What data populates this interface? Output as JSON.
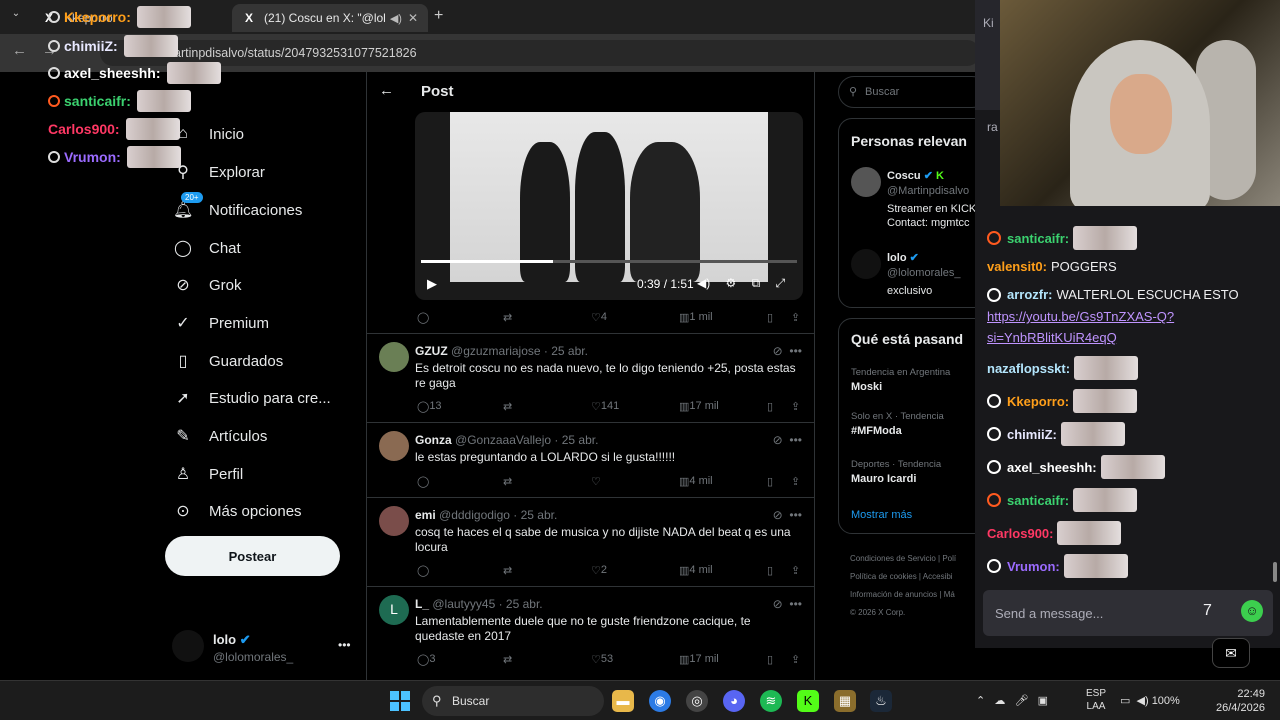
{
  "browser": {
    "tabs": [
      {
        "title": "Kkeporro",
        "favicon": "X"
      },
      {
        "title": "(21) Coscu en X: \"@lolomo",
        "favicon": "X"
      }
    ],
    "url": "artinpdisalvo/status/2047932531077521826",
    "new_tab": "+"
  },
  "left_overlay": [
    {
      "user": "chimiiZ:",
      "color": "#e8e8ff"
    },
    {
      "user": "axel_sheeshh:",
      "color": "#ffffff"
    },
    {
      "user": "santicaifr:",
      "color": "#3bd16f"
    },
    {
      "user": "Carlos900:",
      "color": "#ff3864"
    },
    {
      "user": "Vrumon:",
      "color": "#9b6bff"
    },
    {
      "user": "Kkeporro:",
      "color": "#ff9f1a"
    }
  ],
  "nav": {
    "items": [
      "Inicio",
      "Explorar",
      "Notificaciones",
      "Chat",
      "Grok",
      "Premium",
      "Guardados",
      "Estudio para cre...",
      "Artículos",
      "Perfil",
      "Más opciones"
    ],
    "badge": "20+",
    "post_button": "Postear",
    "profile_name": "lolo",
    "profile_handle": "@lolomorales_"
  },
  "post": {
    "header": "Post",
    "video_time": "0:39 / 1:51",
    "actions": {
      "likes": "4",
      "views": "1 mil"
    }
  },
  "replies": [
    {
      "name": "GZUZ",
      "handle": "@gzuzmariajose",
      "date": "25 abr.",
      "text": "Es detroit coscu no es nada nuevo, te lo digo teniendo +25, posta estas re gaga",
      "replies": "13",
      "likes": "141",
      "views": "17 mil",
      "avatar": "#6a7f55"
    },
    {
      "name": "Gonza",
      "handle": "@GonzaaaVallejo",
      "date": "25 abr.",
      "text": "le estas preguntando a LOLARDO si le gusta!!!!!!",
      "replies": "",
      "likes": "",
      "views": "4 mil",
      "avatar": "#8a6a52"
    },
    {
      "name": "emi",
      "handle": "@dddigodigo",
      "date": "25 abr.",
      "text": "cosq te haces el q sabe de musica y no dijiste NADA del beat q es una locura",
      "replies": "",
      "likes": "2",
      "views": "4 mil",
      "avatar": "#7a4d4a"
    },
    {
      "name": "L_",
      "handle": "@lautyyy45",
      "date": "25 abr.",
      "text": "Lamentablemente duele que no te guste friendzone cacique, te quedaste en 2017",
      "replies": "3",
      "likes": "53",
      "views": "17 mil",
      "avatar": "#1e6b52",
      "initial": "L"
    }
  ],
  "right": {
    "search_placeholder": "Buscar",
    "people_title": "Personas relevan",
    "person1_name": "Coscu",
    "person1_handle": "@Martinpdisalvo",
    "person1_bio1": "Streamer en KICK",
    "person1_bio2": "Contact: mgmtcc",
    "person2_name": "lolo",
    "person2_handle": "@lolomorales_",
    "person2_bio": "exclusivo",
    "trends_title": "Qué está pasand",
    "trends": [
      {
        "context": "Tendencia en Argentina",
        "name": "Moski"
      },
      {
        "context": "Solo en X · Tendencia",
        "name": "#MFModa"
      },
      {
        "context": "Deportes · Tendencia",
        "name": "Mauro Icardi"
      }
    ],
    "show_more": "Mostrar más",
    "footer": [
      "Condiciones de Servicio  |  Polí",
      "Política de cookies  |  Accesibi",
      "Información de anuncios  |  Má",
      "© 2026 X Corp."
    ]
  },
  "chat": {
    "header_text": "Ki",
    "ra_text": "ra",
    "messages": [
      {
        "user": "santicaifr:",
        "color": "#3bd16f",
        "text": "",
        "emote": true
      },
      {
        "user": "valensit0:",
        "color": "#ff9f1a",
        "text": "POGGERS",
        "emote": false
      },
      {
        "user": "arrozfr:",
        "color": "#b3e5fc",
        "text": "WALTERLOL ESCUCHA ESTO",
        "emote": false
      },
      {
        "user": "nazaflopsskt:",
        "color": "#b3e5fc",
        "text": "",
        "emote": true
      },
      {
        "user": "Kkeporro:",
        "color": "#ff9f1a",
        "text": "",
        "emote": true
      },
      {
        "user": "chimiiZ:",
        "color": "#e8e8ff",
        "text": "",
        "emote": true
      },
      {
        "user": "axel_sheeshh:",
        "color": "#ffffff",
        "text": "",
        "emote": true
      },
      {
        "user": "santicaifr:",
        "color": "#3bd16f",
        "text": "",
        "emote": true
      },
      {
        "user": "Carlos900:",
        "color": "#ff3864",
        "text": "",
        "emote": true
      },
      {
        "user": "Vrumon:",
        "color": "#9b6bff",
        "text": "",
        "emote": true
      }
    ],
    "link1": "https://youtu.be/Gs9TnZXAS-Q?",
    "link2": "si=YnbRBlitKUiR4eqQ",
    "input_placeholder": "Send a message..."
  },
  "taskbar": {
    "search": "Buscar",
    "lang1": "ESP",
    "lang2": "LAA",
    "battery": "100%",
    "time": "22:49",
    "date": "26/4/2026"
  }
}
